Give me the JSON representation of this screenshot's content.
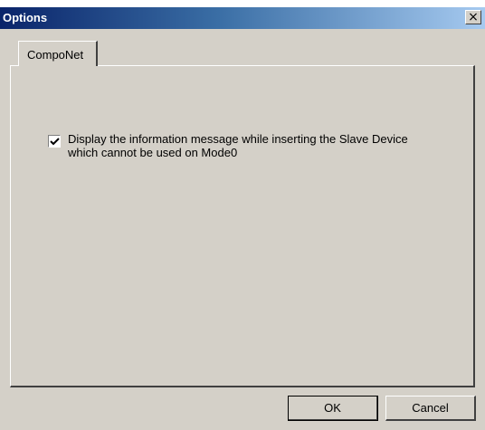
{
  "window": {
    "title": "Options",
    "close_symbol": "×"
  },
  "tabs": [
    {
      "label": "CompoNet",
      "selected": true
    }
  ],
  "option": {
    "checked": true,
    "label_lines": [
      "Display the information message while inserting the Slave Device",
      "which cannot be used on Mode0"
    ]
  },
  "buttons": {
    "ok_label": "OK",
    "cancel_label": "Cancel"
  },
  "colors": {
    "face": "#d4d0c8",
    "title_start": "#0a246a",
    "title_end": "#a6caf0"
  }
}
